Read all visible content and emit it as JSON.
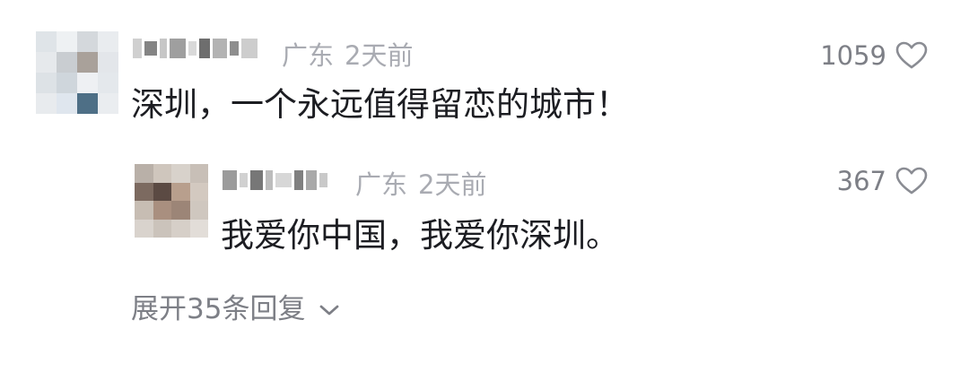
{
  "comment": {
    "location": "广东",
    "time": "2天前",
    "text": "深圳，一个永远值得留恋的城市！",
    "likes": "1059",
    "avatar_colors": [
      "#dfe4e8",
      "#eef1f3",
      "#d4d8dc",
      "#e9ecef",
      "#e6e9ec",
      "#c9cdd1",
      "#a9a19a",
      "#e3e6ea",
      "#dde2e6",
      "#cfd6dc",
      "#eef0f3",
      "#e4e8ec",
      "#e8ebee",
      "#dfe6ee",
      "#4e6f86",
      "#eaedf0"
    ],
    "name_colors": [
      "#c8c8c8",
      "#6f6f6f",
      "#bdbdbd",
      "#8e8e8e",
      "#d2d2d2",
      "#555555",
      "#a6a6a6",
      "#7a7a7a",
      "#c4c4c4"
    ]
  },
  "reply": {
    "location": "广东",
    "time": "2天前",
    "text": "我爱你中国，我爱你深圳。",
    "likes": "367",
    "avatar_colors": [
      "#b9b0a8",
      "#cfc6bd",
      "#d8d2cb",
      "#c8bfb7",
      "#7c6a60",
      "#5b4a43",
      "#b89f8d",
      "#d3c9c0",
      "#c7bdb3",
      "#a98f7f",
      "#9c8577",
      "#cfc7bf",
      "#d9d3cd",
      "#cbc3bb",
      "#d6cfc8",
      "#e2ddd8"
    ],
    "name_colors": [
      "#8a8a8a",
      "#c9c9c9",
      "#5f5f5f",
      "#b0b0b0",
      "#d0d0d0",
      "#6a6a6a",
      "#9a9a9a",
      "#bfbfbf"
    ]
  },
  "expand": {
    "label": "展开35条回复"
  },
  "icons": {
    "like": "heart-outline-icon",
    "expand": "chevron-down-icon"
  },
  "colors": {
    "meta": "#a9abb2",
    "text": "#1c1d22",
    "secondary": "#7d7f86"
  }
}
